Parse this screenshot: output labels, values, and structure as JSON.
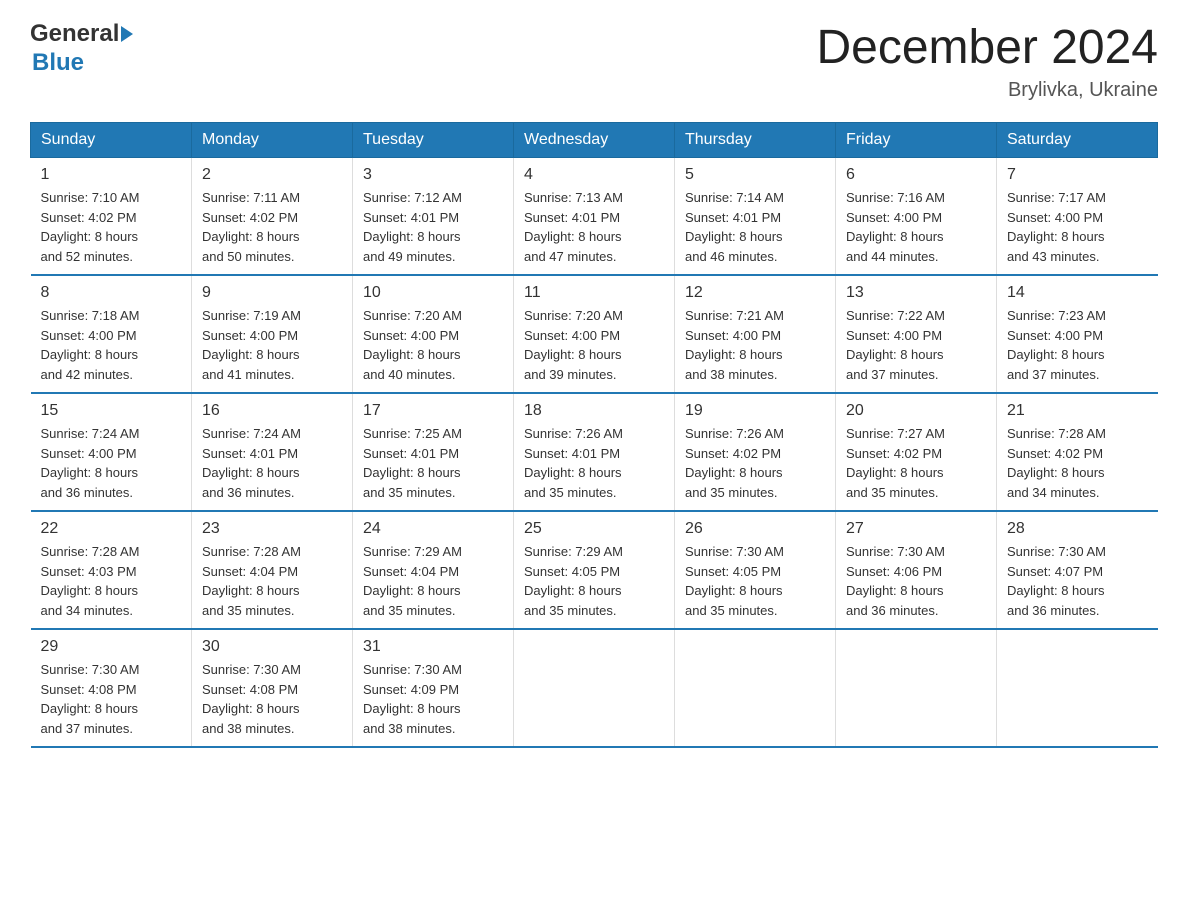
{
  "header": {
    "logo_general": "General",
    "logo_blue": "Blue",
    "month_title": "December 2024",
    "location": "Brylivka, Ukraine"
  },
  "days_of_week": [
    "Sunday",
    "Monday",
    "Tuesday",
    "Wednesday",
    "Thursday",
    "Friday",
    "Saturday"
  ],
  "weeks": [
    [
      {
        "day": "1",
        "info": "Sunrise: 7:10 AM\nSunset: 4:02 PM\nDaylight: 8 hours\nand 52 minutes."
      },
      {
        "day": "2",
        "info": "Sunrise: 7:11 AM\nSunset: 4:02 PM\nDaylight: 8 hours\nand 50 minutes."
      },
      {
        "day": "3",
        "info": "Sunrise: 7:12 AM\nSunset: 4:01 PM\nDaylight: 8 hours\nand 49 minutes."
      },
      {
        "day": "4",
        "info": "Sunrise: 7:13 AM\nSunset: 4:01 PM\nDaylight: 8 hours\nand 47 minutes."
      },
      {
        "day": "5",
        "info": "Sunrise: 7:14 AM\nSunset: 4:01 PM\nDaylight: 8 hours\nand 46 minutes."
      },
      {
        "day": "6",
        "info": "Sunrise: 7:16 AM\nSunset: 4:00 PM\nDaylight: 8 hours\nand 44 minutes."
      },
      {
        "day": "7",
        "info": "Sunrise: 7:17 AM\nSunset: 4:00 PM\nDaylight: 8 hours\nand 43 minutes."
      }
    ],
    [
      {
        "day": "8",
        "info": "Sunrise: 7:18 AM\nSunset: 4:00 PM\nDaylight: 8 hours\nand 42 minutes."
      },
      {
        "day": "9",
        "info": "Sunrise: 7:19 AM\nSunset: 4:00 PM\nDaylight: 8 hours\nand 41 minutes."
      },
      {
        "day": "10",
        "info": "Sunrise: 7:20 AM\nSunset: 4:00 PM\nDaylight: 8 hours\nand 40 minutes."
      },
      {
        "day": "11",
        "info": "Sunrise: 7:20 AM\nSunset: 4:00 PM\nDaylight: 8 hours\nand 39 minutes."
      },
      {
        "day": "12",
        "info": "Sunrise: 7:21 AM\nSunset: 4:00 PM\nDaylight: 8 hours\nand 38 minutes."
      },
      {
        "day": "13",
        "info": "Sunrise: 7:22 AM\nSunset: 4:00 PM\nDaylight: 8 hours\nand 37 minutes."
      },
      {
        "day": "14",
        "info": "Sunrise: 7:23 AM\nSunset: 4:00 PM\nDaylight: 8 hours\nand 37 minutes."
      }
    ],
    [
      {
        "day": "15",
        "info": "Sunrise: 7:24 AM\nSunset: 4:00 PM\nDaylight: 8 hours\nand 36 minutes."
      },
      {
        "day": "16",
        "info": "Sunrise: 7:24 AM\nSunset: 4:01 PM\nDaylight: 8 hours\nand 36 minutes."
      },
      {
        "day": "17",
        "info": "Sunrise: 7:25 AM\nSunset: 4:01 PM\nDaylight: 8 hours\nand 35 minutes."
      },
      {
        "day": "18",
        "info": "Sunrise: 7:26 AM\nSunset: 4:01 PM\nDaylight: 8 hours\nand 35 minutes."
      },
      {
        "day": "19",
        "info": "Sunrise: 7:26 AM\nSunset: 4:02 PM\nDaylight: 8 hours\nand 35 minutes."
      },
      {
        "day": "20",
        "info": "Sunrise: 7:27 AM\nSunset: 4:02 PM\nDaylight: 8 hours\nand 35 minutes."
      },
      {
        "day": "21",
        "info": "Sunrise: 7:28 AM\nSunset: 4:02 PM\nDaylight: 8 hours\nand 34 minutes."
      }
    ],
    [
      {
        "day": "22",
        "info": "Sunrise: 7:28 AM\nSunset: 4:03 PM\nDaylight: 8 hours\nand 34 minutes."
      },
      {
        "day": "23",
        "info": "Sunrise: 7:28 AM\nSunset: 4:04 PM\nDaylight: 8 hours\nand 35 minutes."
      },
      {
        "day": "24",
        "info": "Sunrise: 7:29 AM\nSunset: 4:04 PM\nDaylight: 8 hours\nand 35 minutes."
      },
      {
        "day": "25",
        "info": "Sunrise: 7:29 AM\nSunset: 4:05 PM\nDaylight: 8 hours\nand 35 minutes."
      },
      {
        "day": "26",
        "info": "Sunrise: 7:30 AM\nSunset: 4:05 PM\nDaylight: 8 hours\nand 35 minutes."
      },
      {
        "day": "27",
        "info": "Sunrise: 7:30 AM\nSunset: 4:06 PM\nDaylight: 8 hours\nand 36 minutes."
      },
      {
        "day": "28",
        "info": "Sunrise: 7:30 AM\nSunset: 4:07 PM\nDaylight: 8 hours\nand 36 minutes."
      }
    ],
    [
      {
        "day": "29",
        "info": "Sunrise: 7:30 AM\nSunset: 4:08 PM\nDaylight: 8 hours\nand 37 minutes."
      },
      {
        "day": "30",
        "info": "Sunrise: 7:30 AM\nSunset: 4:08 PM\nDaylight: 8 hours\nand 38 minutes."
      },
      {
        "day": "31",
        "info": "Sunrise: 7:30 AM\nSunset: 4:09 PM\nDaylight: 8 hours\nand 38 minutes."
      },
      {
        "day": "",
        "info": ""
      },
      {
        "day": "",
        "info": ""
      },
      {
        "day": "",
        "info": ""
      },
      {
        "day": "",
        "info": ""
      }
    ]
  ]
}
